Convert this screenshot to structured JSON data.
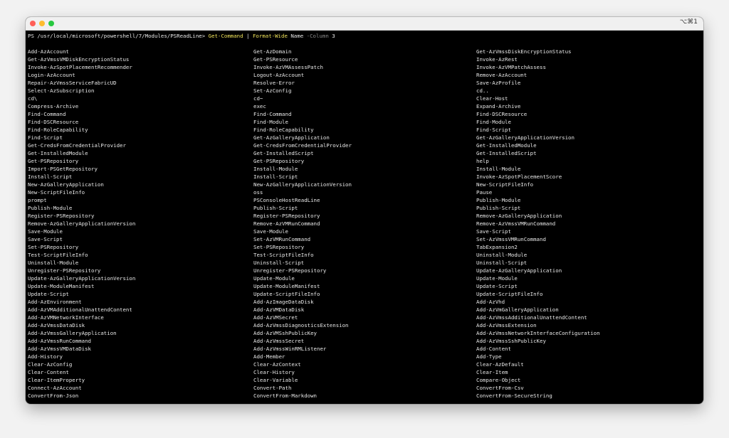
{
  "window": {
    "shortcut": "⌥⌘1"
  },
  "prompt": {
    "path": "PS /usr/local/microsoft/powershell/7/Modules/PSReadLine>",
    "command": "Get-Command",
    "pipe": "|",
    "cmdlet": "Format-Wide",
    "arg": "Name",
    "param": "-Column",
    "value": "3"
  },
  "columns": [
    [
      "Add-AzAccount",
      "Get-AzVmssVMDiskEncryptionStatus",
      "Invoke-AzSpotPlacementRecommender",
      "Login-AzAccount",
      "Repair-AzVmssServiceFabricUD",
      "Select-AzSubscription",
      "cd\\",
      "Compress-Archive",
      "Find-Command",
      "Find-DSCResource",
      "Find-RoleCapability",
      "Find-Script",
      "Get-CredsFromCredentialProvider",
      "Get-InstalledModule",
      "Get-PSRepository",
      "Import-PSGetRepository",
      "Install-Script",
      "New-AzGalleryApplication",
      "New-ScriptFileInfo",
      "prompt",
      "Publish-Module",
      "Register-PSRepository",
      "Remove-AzGalleryApplicationVersion",
      "Save-Module",
      "Save-Script",
      "Set-PSRepository",
      "Test-ScriptFileInfo",
      "Uninstall-Module",
      "Unregister-PSRepository",
      "Update-AzGalleryApplicationVersion",
      "Update-ModuleManifest",
      "Update-Script",
      "Add-AzEnvironment",
      "Add-AzVMAdditionalUnattendContent",
      "Add-AzVMNetworkInterface",
      "Add-AzVmssDataDisk",
      "Add-AzVmssGalleryApplication",
      "Add-AzVmssRunCommand",
      "Add-AzVmssVMDataDisk",
      "Add-History",
      "Clear-AzConfig",
      "Clear-Content",
      "Clear-ItemProperty",
      "Connect-AzAccount",
      "ConvertFrom-Json"
    ],
    [
      "Get-AzDomain",
      "Get-PSResource",
      "Invoke-AzVMAssessPatch",
      "Logout-AzAccount",
      "Resolve-Error",
      "Set-AzConfig",
      "cd~",
      "exec",
      "Find-Command",
      "Find-Module",
      "Find-RoleCapability",
      "Get-AzGalleryApplication",
      "Get-CredsFromCredentialProvider",
      "Get-InstalledScript",
      "Get-PSRepository",
      "Install-Module",
      "Install-Script",
      "New-AzGalleryApplicationVersion",
      "oss",
      "PSConsoleHostReadLine",
      "Publish-Script",
      "Register-PSRepository",
      "Remove-AzVMRunCommand",
      "Save-Module",
      "Set-AzVMRunCommand",
      "Set-PSRepository",
      "Test-ScriptFileInfo",
      "Uninstall-Script",
      "Unregister-PSRepository",
      "Update-Module",
      "Update-ModuleManifest",
      "Update-ScriptFileInfo",
      "Add-AzImageDataDisk",
      "Add-AzVMDataDisk",
      "Add-AzVMSecret",
      "Add-AzVmssDiagnosticsExtension",
      "Add-AzVMSshPublicKey",
      "Add-AzVmssSecret",
      "Add-AzVmssWinRMListener",
      "Add-Member",
      "Clear-AzContext",
      "Clear-History",
      "Clear-Variable",
      "Convert-Path",
      "ConvertFrom-Markdown"
    ],
    [
      "Get-AzVmssDiskEncryptionStatus",
      "Invoke-AzRest",
      "Invoke-AzVMPatchAssess",
      "Remove-AzAccount",
      "Save-AzProfile",
      "cd..",
      "Clear-Host",
      "Expand-Archive",
      "Find-DSCResource",
      "Find-Module",
      "Find-Script",
      "Get-AzGalleryApplicationVersion",
      "Get-InstalledModule",
      "Get-InstalledScript",
      "help",
      "Install-Module",
      "Invoke-AzSpotPlacementScore",
      "New-ScriptFileInfo",
      "Pause",
      "Publish-Module",
      "Publish-Script",
      "Remove-AzGalleryApplication",
      "Remove-AzVmssVMRunCommand",
      "Save-Script",
      "Set-AzVmssVMRunCommand",
      "TabExpansion2",
      "Uninstall-Module",
      "Uninstall-Script",
      "Update-AzGalleryApplication",
      "Update-Module",
      "Update-Script",
      "Update-ScriptFileInfo",
      "Add-AzVhd",
      "Add-AzVmGalleryApplication",
      "Add-AzVmssAdditionalUnattendContent",
      "Add-AzVmssExtension",
      "Add-AzVmssNetworkInterfaceConfiguration",
      "Add-AzVmssSshPublicKey",
      "Add-Content",
      "Add-Type",
      "Clear-AzDefault",
      "Clear-Item",
      "Compare-Object",
      "ConvertFrom-Csv",
      "ConvertFrom-SecureString"
    ]
  ]
}
